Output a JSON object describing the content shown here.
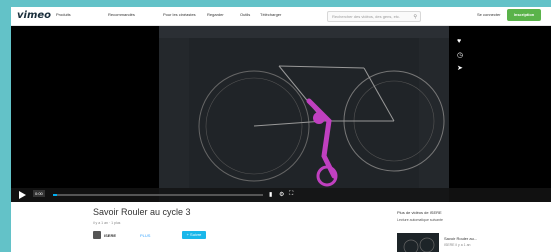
{
  "header": {
    "logo": "vimeo",
    "nav": [
      "Produits",
      "Recommandés",
      "Pour les cinéastes",
      "Regarder",
      "Outils",
      "Télécharger"
    ],
    "search_placeholder": "Rechercher des vidéos, des gens, etc.",
    "signin": "Se connecter",
    "join": "Inscription"
  },
  "player": {
    "time": "0:00",
    "progress_fraction": 0.02,
    "icons": [
      "heart-icon",
      "clock-icon",
      "share-icon",
      "play-icon",
      "volume-icon",
      "settings-icon",
      "fullscreen-icon"
    ]
  },
  "video": {
    "title": "Savoir Rouler au cycle 3",
    "meta": "il y a 1 an · 1 plus",
    "owner": "ISERE",
    "owner_plus": "PLUS",
    "follow": "+ Suivre"
  },
  "sidebar": {
    "heading": "Plus de vidéos de ISERE",
    "subtitle": "Lecture automatique suivante",
    "recommended": [
      {
        "title": "Savoir Rouler au...",
        "meta": "ISERE il y a 1 an"
      }
    ]
  },
  "colors": {
    "background": "#63c2c8",
    "accent": "#1ab7ea",
    "join": "#5ab34a",
    "player": "#000000"
  }
}
